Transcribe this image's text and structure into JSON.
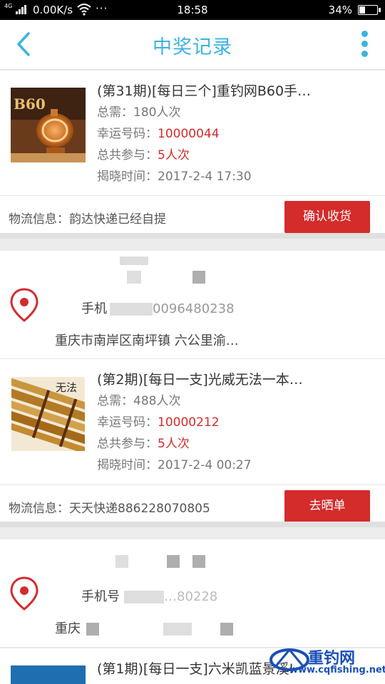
{
  "status_bar": {
    "network": "4G",
    "speed": "0.00K/s",
    "more": "···",
    "time": "18:58",
    "battery_pct": "34%",
    "battery_level": 0.34
  },
  "header": {
    "title": "中奖记录"
  },
  "orders": [
    {
      "title": "(第31期)[每日三个]重钓网B60手…",
      "total_need": "总需：180人次",
      "lucky_label": "幸运号码：",
      "lucky_number": "10000044",
      "participate_label": "总共参与：",
      "participate_value": "5人次",
      "reveal_time": "揭晓时间：2017-2-4 17:30",
      "logistics": "物流信息：韵达快递已经自提",
      "action": "确认收货"
    },
    {
      "title": "(第2期)[每日一支]光威无法一本…",
      "total_need": "总需：488人次",
      "lucky_label": "幸运号码：",
      "lucky_number": "10000212",
      "participate_label": "总共参与：",
      "participate_value": "5人次",
      "reveal_time": "揭晓时间：2017-2-4 00:27",
      "logistics": "物流信息：天天快递886228070805",
      "action": "去晒单"
    },
    {
      "title": "(第1期)[每日一支]六米凯蓝景溪I"
    }
  ],
  "addresses": [
    {
      "phone": "手机",
      "phone_partial": "0096480238",
      "street": "重庆市南岸区南坪镇 六公里渝…"
    },
    {
      "phone": "手机号",
      "phone_partial": "…80228",
      "street": "重庆"
    }
  ],
  "thumb_text": {
    "b60": "B60",
    "box": "无法"
  },
  "watermark": {
    "brand": "重钓网",
    "url": "www.cqfishing.net"
  },
  "colors": {
    "accent": "#3bb3e0",
    "red": "#d42b2b"
  }
}
